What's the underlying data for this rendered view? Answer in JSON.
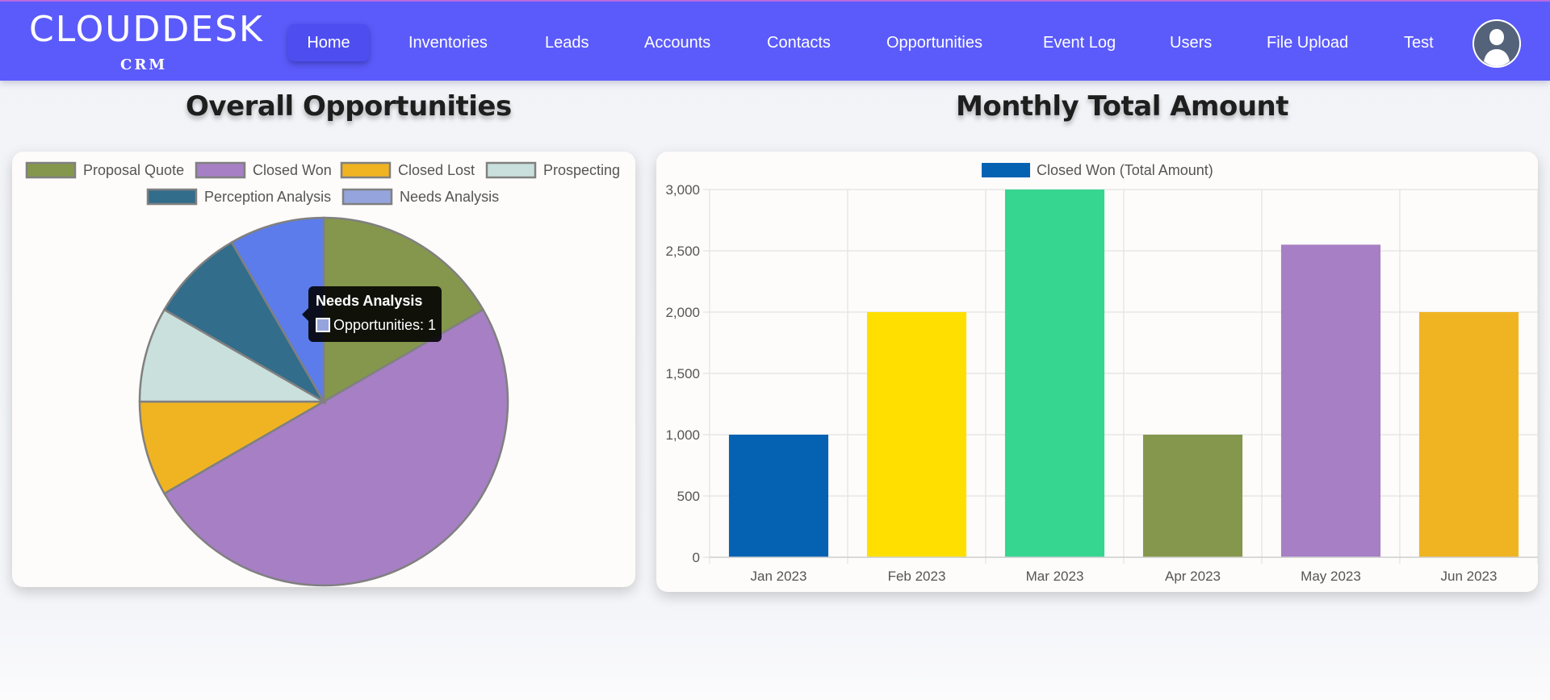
{
  "brand": {
    "name": "CLOUDDESK",
    "sub": "CRM"
  },
  "nav": {
    "items": [
      {
        "label": "Home"
      },
      {
        "label": "Inventories"
      },
      {
        "label": "Leads"
      },
      {
        "label": "Accounts"
      },
      {
        "label": "Contacts"
      },
      {
        "label": "Opportunities"
      },
      {
        "label": "Event Log"
      },
      {
        "label": "Users"
      },
      {
        "label": "File Upload"
      },
      {
        "label": "Test"
      }
    ],
    "active": "Home",
    "avatar_icon": "user-avatar-icon"
  },
  "colors": {
    "nav_bg": "#5b5bfb",
    "card_bg": "#fdfcfa"
  },
  "pie_section": {
    "title": "Overall Opportunities"
  },
  "bar_section": {
    "title": "Monthly Total Amount"
  },
  "tooltip": {
    "title": "Needs Analysis",
    "label": "Opportunities: 1"
  },
  "chart_data": [
    {
      "type": "pie",
      "title": "Overall Opportunities",
      "legend_position": "top",
      "categories": [
        "Proposal Quote",
        "Closed Won",
        "Closed Lost",
        "Prospecting",
        "Perception Analysis",
        "Needs Analysis"
      ],
      "values": [
        2,
        6,
        1,
        1,
        1,
        1
      ],
      "colors": [
        "#85974c",
        "#a67fc4",
        "#f0b423",
        "#c9e0dc",
        "#326d8b",
        "#5b7cea"
      ],
      "legend_colors": [
        "#85974c",
        "#a67fc4",
        "#f0b423",
        "#c9e0dc",
        "#326d8b",
        "#95a4dd"
      ]
    },
    {
      "type": "bar",
      "title": "Monthly Total Amount",
      "legend_position": "top",
      "categories": [
        "Jan 2023",
        "Feb 2023",
        "Mar 2023",
        "Apr 2023",
        "May 2023",
        "Jun 2023"
      ],
      "series": [
        {
          "name": "Closed Won (Total Amount)",
          "values": [
            1000,
            2000,
            3000,
            1000,
            2550,
            2000
          ]
        }
      ],
      "bar_colors": [
        "#0562b3",
        "#ffdf00",
        "#36d690",
        "#85974c",
        "#a67fc4",
        "#f0b423"
      ],
      "legend_color": "#0562b3",
      "ylim": [
        0,
        3000
      ],
      "yticks": [
        0,
        500,
        1000,
        1500,
        2000,
        2500,
        3000
      ],
      "ytick_labels": [
        "0",
        "500",
        "1,000",
        "1,500",
        "2,000",
        "2,500",
        "3,000"
      ],
      "grid": true
    }
  ]
}
